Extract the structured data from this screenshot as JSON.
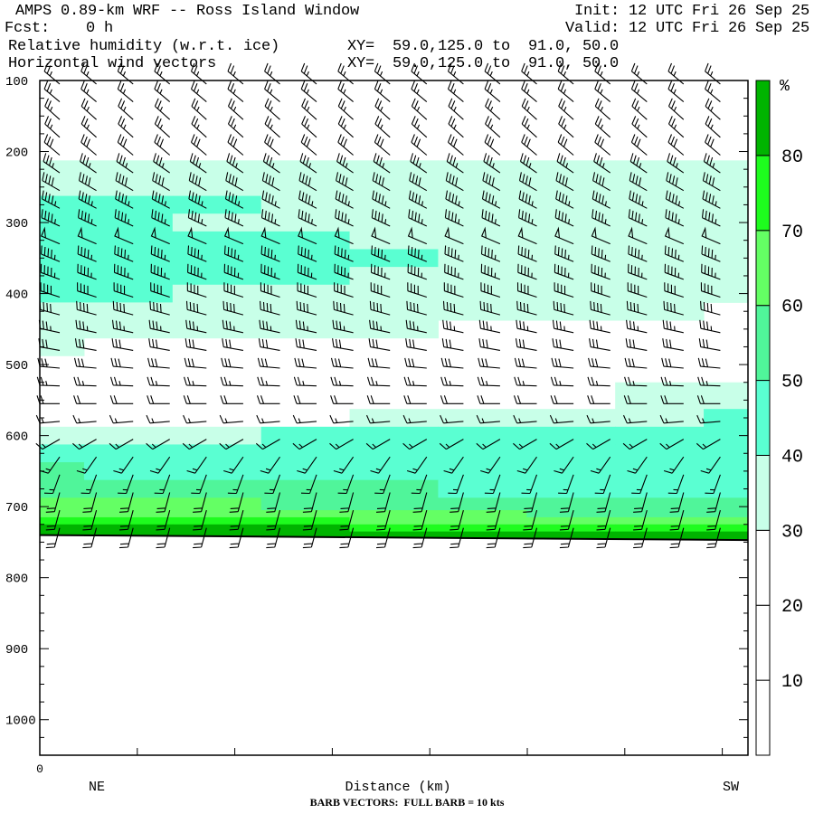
{
  "header": {
    "title": "AMPS 0.89-km WRF -- Ross Island Window",
    "init": "Init: 12 UTC Fri 26 Sep 25",
    "fcst": "Fcst:    0 h",
    "valid": "Valid: 12 UTC Fri 26 Sep 25",
    "field1": "Relative humidity (w.r.t. ice)",
    "field1_xy": "XY=  59.0,125.0 to  91.0, 50.0",
    "field2": "Horizontal wind vectors",
    "field2_xy": "XY=  59.0,125.0 to  91.0, 50.0"
  },
  "footer": {
    "barb_note": "BARB VECTORS:  FULL BARB = 10 kts"
  },
  "chart_data": {
    "type": "heatmap",
    "title": "Relative humidity (w.r.t. ice) cross-section with horizontal wind barbs",
    "xlabel": "Distance (km)",
    "x_start_label": "0",
    "x_left_label": "NE",
    "x_right_label": "SW",
    "ylabel": "",
    "ylim": [
      1050,
      100
    ],
    "y_ticks": [
      "100",
      "200",
      "300",
      "400",
      "500",
      "600",
      "700",
      "800",
      "900",
      "1000"
    ],
    "y_tick_values": [
      100,
      200,
      300,
      400,
      500,
      600,
      700,
      800,
      900,
      1000
    ],
    "x_fraction_columns": [
      0,
      0.125,
      0.25,
      0.375,
      0.5,
      0.625,
      0.75,
      0.875,
      1
    ],
    "pressure_levels": [
      100,
      150,
      200,
      225,
      250,
      275,
      300,
      325,
      350,
      375,
      400,
      425,
      450,
      475,
      500,
      550,
      575,
      600,
      625,
      650,
      675,
      700,
      710,
      720,
      730,
      740
    ],
    "rh": [
      [
        20,
        20,
        20,
        20,
        20,
        20,
        20,
        20,
        20
      ],
      [
        20,
        20,
        20,
        20,
        20,
        20,
        20,
        20,
        20
      ],
      [
        20,
        20,
        20,
        20,
        20,
        20,
        20,
        20,
        20
      ],
      [
        35,
        35,
        35,
        35,
        35,
        35,
        35,
        35,
        35
      ],
      [
        35,
        35,
        35,
        35,
        35,
        35,
        35,
        35,
        35
      ],
      [
        45,
        45,
        45,
        35,
        35,
        35,
        35,
        35,
        35
      ],
      [
        45,
        45,
        35,
        35,
        35,
        35,
        35,
        35,
        35
      ],
      [
        45,
        45,
        45,
        45,
        35,
        35,
        35,
        35,
        35
      ],
      [
        45,
        45,
        45,
        45,
        45,
        35,
        35,
        35,
        35
      ],
      [
        45,
        45,
        45,
        45,
        35,
        35,
        35,
        35,
        35
      ],
      [
        45,
        45,
        35,
        35,
        35,
        35,
        35,
        35,
        35
      ],
      [
        35,
        35,
        35,
        35,
        35,
        35,
        35,
        35,
        25
      ],
      [
        35,
        35,
        35,
        35,
        35,
        25,
        25,
        25,
        25
      ],
      [
        35,
        25,
        25,
        25,
        25,
        25,
        25,
        25,
        25
      ],
      [
        25,
        25,
        25,
        25,
        25,
        25,
        25,
        25,
        25
      ],
      [
        25,
        25,
        25,
        25,
        25,
        25,
        25,
        35,
        35
      ],
      [
        25,
        25,
        25,
        25,
        35,
        35,
        35,
        35,
        45
      ],
      [
        35,
        35,
        35,
        45,
        45,
        45,
        45,
        45,
        45
      ],
      [
        45,
        45,
        45,
        45,
        45,
        45,
        45,
        45,
        45
      ],
      [
        55,
        45,
        45,
        45,
        45,
        45,
        45,
        45,
        45
      ],
      [
        55,
        55,
        55,
        55,
        55,
        45,
        45,
        45,
        45
      ],
      [
        65,
        65,
        65,
        55,
        55,
        55,
        55,
        55,
        55
      ],
      [
        65,
        65,
        65,
        65,
        65,
        65,
        55,
        55,
        55
      ],
      [
        75,
        75,
        75,
        75,
        65,
        65,
        65,
        65,
        65
      ],
      [
        85,
        85,
        85,
        85,
        75,
        75,
        75,
        75,
        75
      ],
      [
        85,
        85,
        85,
        85,
        85,
        85,
        85,
        85,
        85
      ]
    ],
    "surface_pressure_left": 740,
    "surface_pressure_right": 747,
    "colorbar": {
      "unit": "%",
      "levels": [
        0,
        10,
        20,
        30,
        40,
        50,
        60,
        70,
        80,
        90
      ],
      "labels": [
        "10",
        "20",
        "30",
        "40",
        "50",
        "60",
        "70",
        "80"
      ],
      "colors": [
        "#ffffff",
        "#ffffff",
        "#ffffff",
        "#c8ffe8",
        "#5affd2",
        "#50f59a",
        "#64ff64",
        "#1efc1e",
        "#00b400"
      ]
    },
    "wind_barbs": {
      "columns": 19,
      "levels": [
        {
          "p": 105,
          "dir": 310,
          "spd": 25
        },
        {
          "p": 130,
          "dir": 310,
          "spd": 25
        },
        {
          "p": 155,
          "dir": 312,
          "spd": 25
        },
        {
          "p": 180,
          "dir": 312,
          "spd": 25
        },
        {
          "p": 205,
          "dir": 310,
          "spd": 30
        },
        {
          "p": 230,
          "dir": 305,
          "spd": 35
        },
        {
          "p": 255,
          "dir": 300,
          "spd": 40
        },
        {
          "p": 280,
          "dir": 298,
          "spd": 45
        },
        {
          "p": 305,
          "dir": 295,
          "spd": 45
        },
        {
          "p": 330,
          "dir": 293,
          "spd": 50
        },
        {
          "p": 355,
          "dir": 292,
          "spd": 45
        },
        {
          "p": 380,
          "dir": 290,
          "spd": 45
        },
        {
          "p": 405,
          "dir": 288,
          "spd": 40
        },
        {
          "p": 430,
          "dir": 285,
          "spd": 40
        },
        {
          "p": 455,
          "dir": 282,
          "spd": 35
        },
        {
          "p": 480,
          "dir": 280,
          "spd": 30
        },
        {
          "p": 505,
          "dir": 275,
          "spd": 30
        },
        {
          "p": 530,
          "dir": 272,
          "spd": 25
        },
        {
          "p": 555,
          "dir": 270,
          "spd": 20
        },
        {
          "p": 580,
          "dir": 265,
          "spd": 15
        },
        {
          "p": 605,
          "dir": 240,
          "spd": 15
        },
        {
          "p": 630,
          "dir": 215,
          "spd": 15
        },
        {
          "p": 655,
          "dir": 200,
          "spd": 15
        },
        {
          "p": 680,
          "dir": 195,
          "spd": 20
        },
        {
          "p": 705,
          "dir": 195,
          "spd": 20
        },
        {
          "p": 730,
          "dir": 195,
          "spd": 20
        }
      ]
    }
  }
}
